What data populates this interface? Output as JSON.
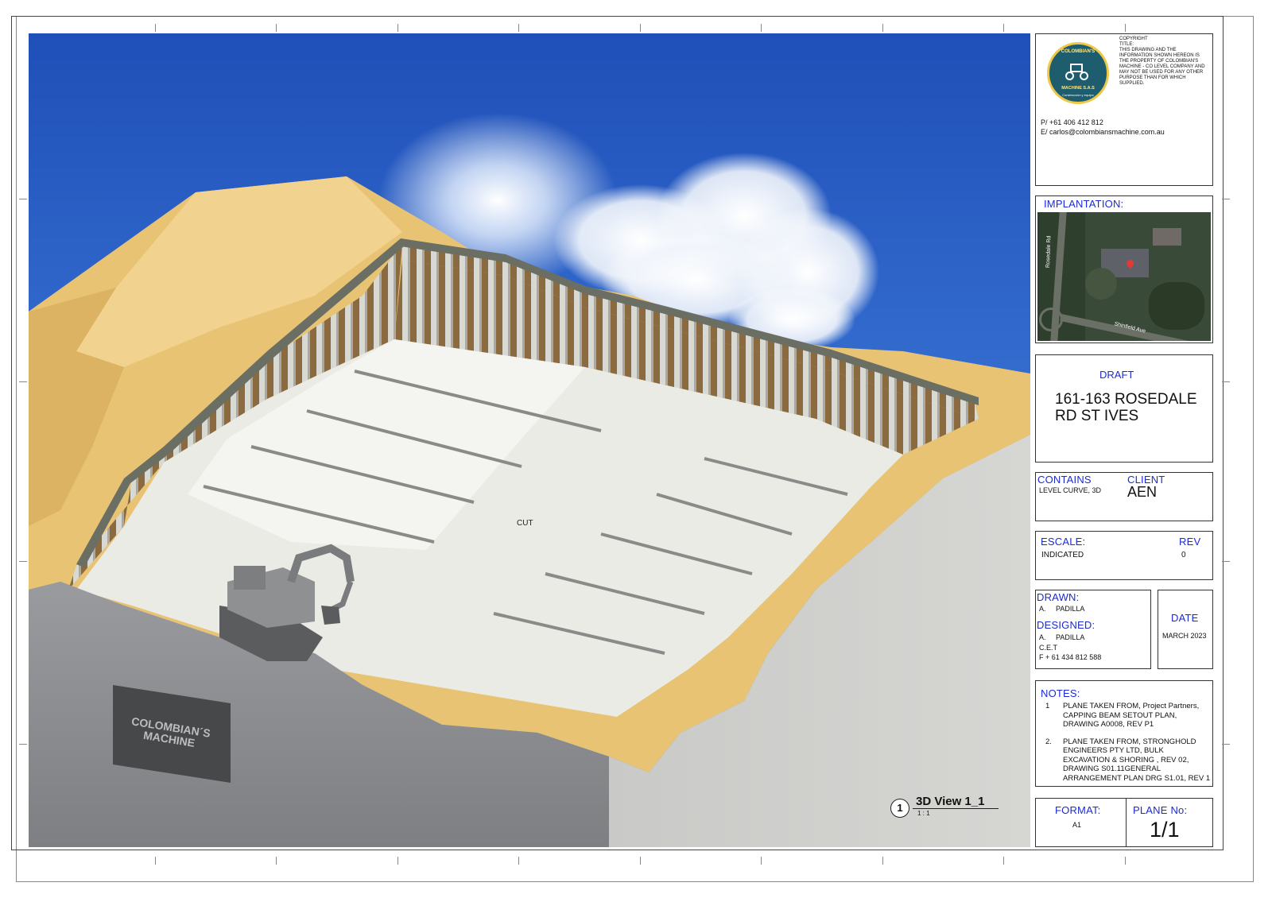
{
  "render": {
    "cut_label": "CUT",
    "sign_line1": "COLOMBIAN´S",
    "sign_line2": "MACHINE"
  },
  "view": {
    "number": "1",
    "title": "3D View 1_1",
    "scale": "1 : 1"
  },
  "logo": {
    "top_text": "COLOMBIAN'S",
    "bottom_text": "MACHINE S.A.S",
    "tagline": "Construcción y equipo"
  },
  "copyright": {
    "heading": "COPYRIGHT",
    "title_label": "TITLE:",
    "text": "THIS DRAWING AND THE INFORMATION SHOWN HEREON IS THE PROPERTY OF COLOMBIAN'S MACHINE - CO LEVEL COMPANY AND MAY NOT BE USED FOR ANY OTHER PURPOSE THAN FOR WHICH SUPPLIED."
  },
  "contact": {
    "phone": "P/ +61 406 412 812",
    "email": "E/ carlos@colombiansmachine.com.au"
  },
  "implantation": {
    "label": "IMPLANTATION:",
    "street1": "Rosedale Rd",
    "street2": "Shinfield Ave"
  },
  "project": {
    "status": "DRAFT",
    "name_line1": "161-163 ROSEDALE",
    "name_line2": "RD ST IVES"
  },
  "contains": {
    "label": "CONTAINS",
    "value": "LEVEL CURVE, 3D"
  },
  "client": {
    "label": "CLIENT",
    "value": "AEN"
  },
  "escale": {
    "label": "ESCALE:",
    "value": "INDICATED"
  },
  "rev": {
    "label": "REV",
    "value": "0"
  },
  "drawn": {
    "label": "DRAWN:",
    "value": "A.     PADILLA"
  },
  "designed": {
    "label": "DESIGNED:",
    "value": "A.     PADILLA",
    "line2": "C.E.T",
    "line3": "F + 61 434 812 588"
  },
  "date": {
    "label": "DATE",
    "value": "MARCH 2023"
  },
  "notes": {
    "label": "NOTES:",
    "items": [
      {
        "num": "1",
        "text": "PLANE TAKEN FROM, Project Partners, CAPPING BEAM SETOUT PLAN, DRAWING A0008, REV P1"
      },
      {
        "num": "2.",
        "text": "PLANE TAKEN FROM, STRONGHOLD ENGINEERS PTY LTD, BULK EXCAVATION & SHORING , REV 02, DRAWING S01.11GENERAL ARRANGEMENT PLAN DRG S1.01, REV 1"
      }
    ]
  },
  "format": {
    "label": "FORMAT:",
    "value": "A1"
  },
  "plane": {
    "label": "PLANE No:",
    "value": "1/1"
  },
  "colors": {
    "sky_top": "#2a5fc4",
    "sand": "#e9c47a",
    "wall": "#8c8d90",
    "floor": "#ebebe6",
    "accent_blue": "#1a2bd6"
  }
}
